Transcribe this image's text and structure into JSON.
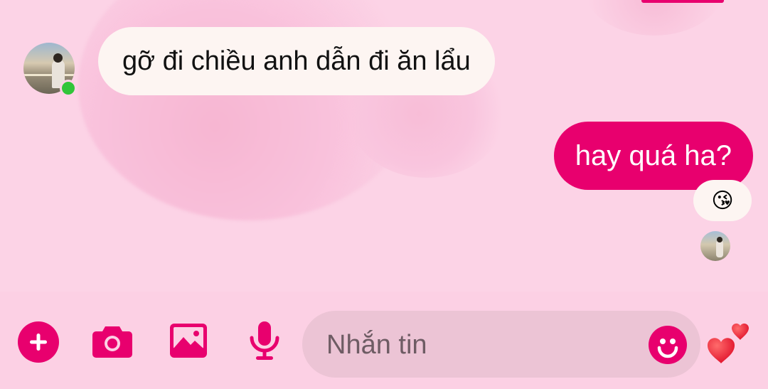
{
  "conversation": {
    "incoming": {
      "text": "gỡ đi chiều anh dẫn đi ăn lẩu",
      "sender_online": true
    },
    "outgoing": {
      "text": "hay quá ha?",
      "reaction": "😘",
      "seen": true
    }
  },
  "composer": {
    "placeholder": "Nhắn tin",
    "icons": [
      "plus-icon",
      "camera-icon",
      "image-icon",
      "mic-icon",
      "emoji-icon",
      "hearts-icon"
    ]
  },
  "colors": {
    "accent": "#e8006e",
    "background": "#fcd3e6",
    "incoming_bubble": "#fdf5f2",
    "composer_field": "#ecc4d5",
    "online": "#31c53a"
  }
}
